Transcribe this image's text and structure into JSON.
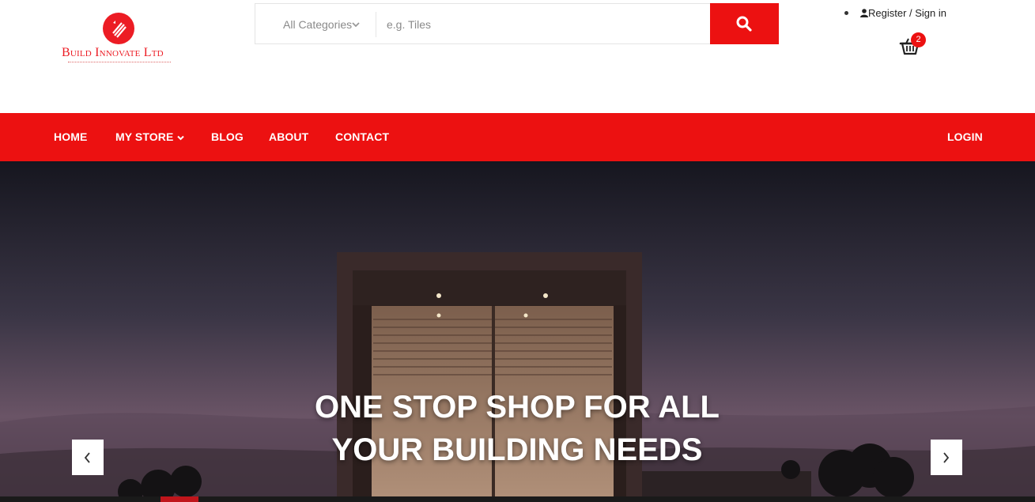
{
  "brand": {
    "name": "Build Innovate Ltd",
    "accent_color": "#ec1111"
  },
  "search": {
    "category_label": "All Categories",
    "placeholder": "e.g. Tiles",
    "button_icon": "search-icon"
  },
  "account": {
    "icon": "user-icon",
    "link_label": "Register / Sign in"
  },
  "cart": {
    "icon": "basket-icon",
    "count": "2"
  },
  "nav": {
    "items": [
      {
        "label": "HOME"
      },
      {
        "label": "MY STORE",
        "has_dropdown": true
      },
      {
        "label": "BLOG"
      },
      {
        "label": "ABOUT"
      },
      {
        "label": "CONTACT"
      }
    ],
    "login_label": "LOGIN"
  },
  "hero": {
    "title_line1": "ONE STOP SHOP FOR ALL",
    "title_line2": "YOUR BUILDING NEEDS",
    "prev_icon": "chevron-left-icon",
    "next_icon": "chevron-right-icon"
  }
}
